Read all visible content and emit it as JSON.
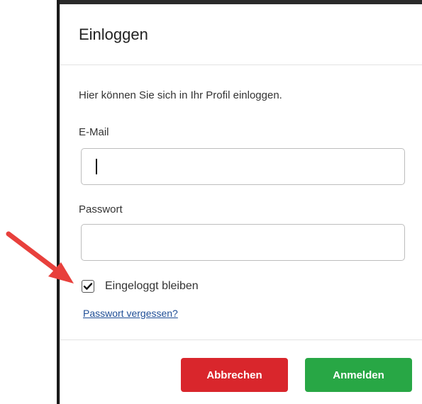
{
  "dialog": {
    "title": "Einloggen",
    "intro": "Hier können Sie sich in Ihr Profil einloggen."
  },
  "form": {
    "email": {
      "label": "E-Mail",
      "value": ""
    },
    "password": {
      "label": "Passwort",
      "value": ""
    },
    "remember": {
      "label": "Eingeloggt bleiben",
      "checked": true
    },
    "forgot_link": "Passwort vergessen?"
  },
  "footer": {
    "cancel_label": "Abbrechen",
    "login_label": "Anmelden"
  },
  "colors": {
    "cancel": "#d9262c",
    "login": "#28a745",
    "link": "#1f4e96",
    "annotation_arrow": "#e8403c"
  },
  "annotation": {
    "icon": "red-pointer-arrow-icon",
    "target": "remember-checkbox"
  }
}
